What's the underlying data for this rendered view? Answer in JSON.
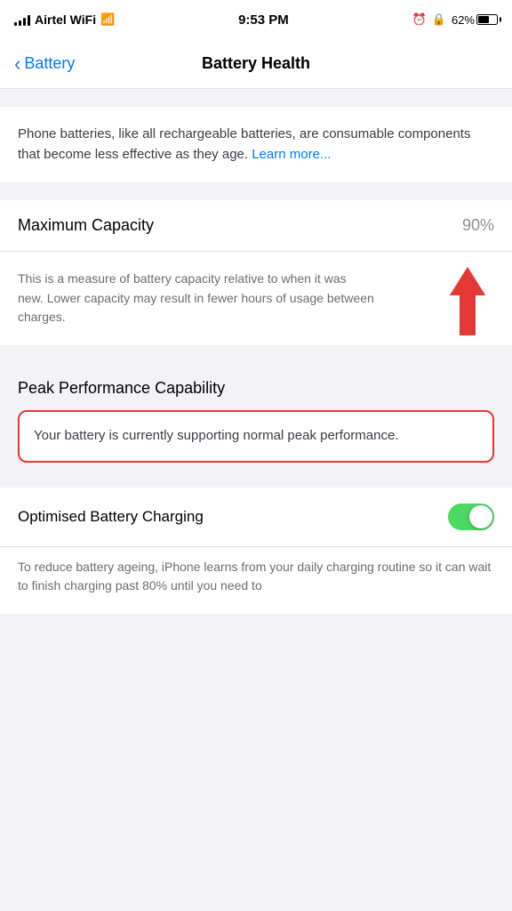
{
  "statusBar": {
    "carrier": "Airtel WiFi",
    "time": "9:53 PM",
    "batteryPercent": "62%"
  },
  "navBar": {
    "backLabel": "Battery",
    "title": "Battery Health"
  },
  "introSection": {
    "text": "Phone batteries, like all rechargeable batteries, are consumable components that become less effective as they age.",
    "learnMoreLabel": "Learn more..."
  },
  "maximumCapacity": {
    "label": "Maximum Capacity",
    "value": "90%",
    "description": "This is a measure of battery capacity relative to when it was new. Lower capacity may result in fewer hours of usage between charges."
  },
  "peakPerformance": {
    "title": "Peak Performance Capability",
    "statusText": "Your battery is currently supporting normal peak performance."
  },
  "optimisedCharging": {
    "label": "Optimised Battery Charging",
    "enabled": true
  },
  "bottomDescription": {
    "text": "To reduce battery ageing, iPhone learns from your daily charging routine so it can wait to finish charging past 80% until you need to"
  }
}
